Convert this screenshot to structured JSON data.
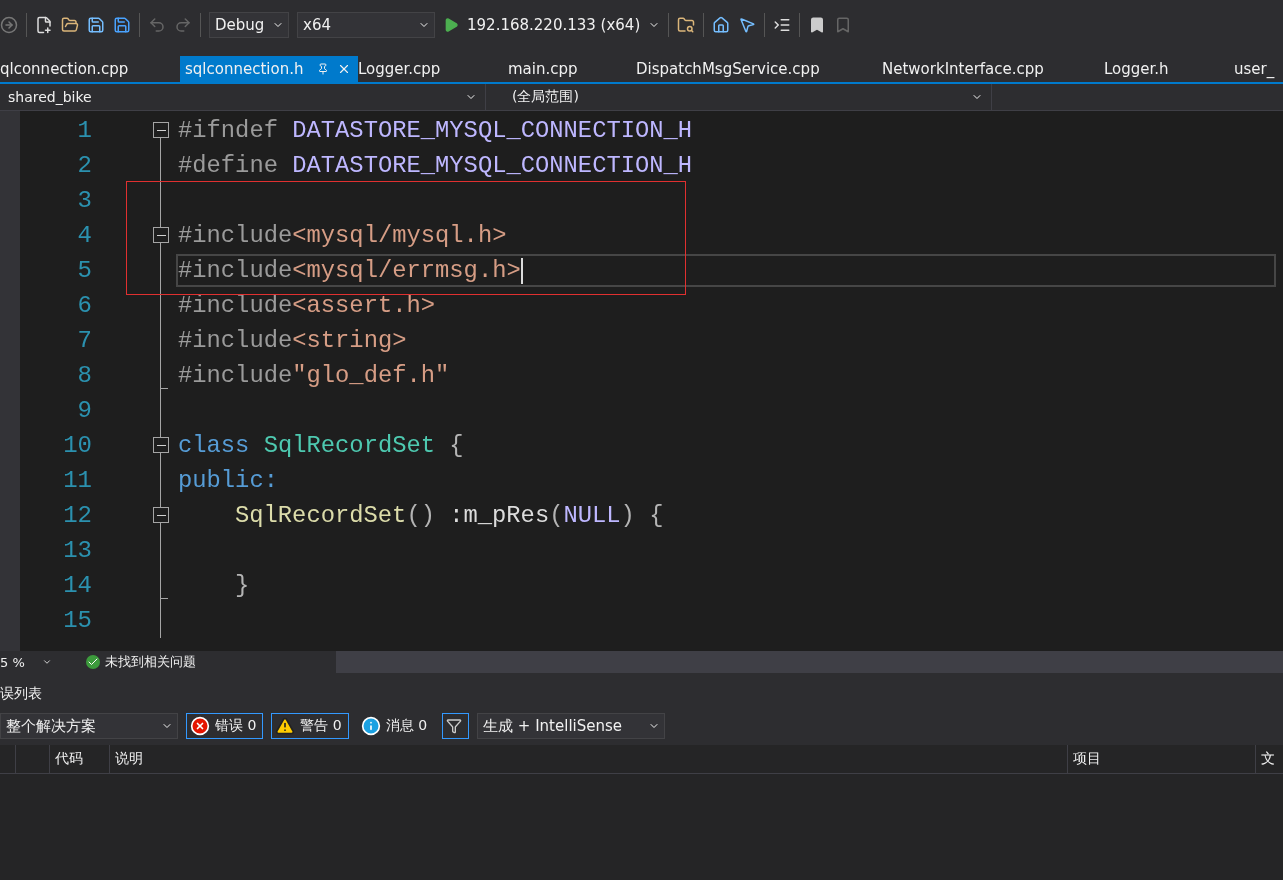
{
  "toolbar": {
    "configuration": "Debug",
    "platform": "x64",
    "run_target": "192.168.220.133 (x64)"
  },
  "tabs": [
    {
      "label": "qlconnection.cpp",
      "selected": false
    },
    {
      "label": "sqlconnection.h",
      "selected": true
    },
    {
      "label": "Logger.cpp",
      "selected": false
    },
    {
      "label": "main.cpp",
      "selected": false
    },
    {
      "label": "DispatchMsgService.cpp",
      "selected": false
    },
    {
      "label": "NetworkInterface.cpp",
      "selected": false
    },
    {
      "label": "Logger.h",
      "selected": false
    },
    {
      "label": "user_",
      "selected": false
    }
  ],
  "navigation": {
    "project": "shared_bike",
    "scope": "(全局范围)"
  },
  "editor": {
    "lines": [
      {
        "number": "1",
        "collapsible": true,
        "fold_end": false,
        "indented": false,
        "current": false,
        "tokens": [
          {
            "kind": "preproc",
            "text": "#ifndef "
          },
          {
            "kind": "macro",
            "text": "DATASTORE_MYSQL_CONNECTION_H"
          }
        ]
      },
      {
        "number": "2",
        "collapsible": false,
        "fold_end": false,
        "indented": false,
        "current": false,
        "tokens": [
          {
            "kind": "preproc",
            "text": "#define "
          },
          {
            "kind": "macro",
            "text": "DATASTORE_MYSQL_CONNECTION_H"
          }
        ]
      },
      {
        "number": "3",
        "collapsible": false,
        "fold_end": false,
        "indented": false,
        "current": false
      },
      {
        "number": "4",
        "collapsible": true,
        "fold_end": false,
        "indented": false,
        "current": false,
        "tokens": [
          {
            "kind": "preproc",
            "text": "#include"
          },
          {
            "kind": "string",
            "text": "<mysql/mysql.h>"
          }
        ]
      },
      {
        "number": "5",
        "collapsible": false,
        "fold_end": false,
        "indented": false,
        "current": true,
        "tokens": [
          {
            "kind": "preproc",
            "text": "#include"
          },
          {
            "kind": "string",
            "text": "<mysql/errmsg.h>"
          }
        ]
      },
      {
        "number": "6",
        "collapsible": false,
        "fold_end": false,
        "indented": false,
        "current": false,
        "tokens": [
          {
            "kind": "preproc",
            "text": "#include"
          },
          {
            "kind": "string",
            "text": "<assert.h>"
          }
        ]
      },
      {
        "number": "7",
        "collapsible": false,
        "fold_end": false,
        "indented": false,
        "current": false,
        "tokens": [
          {
            "kind": "preproc",
            "text": "#include"
          },
          {
            "kind": "string",
            "text": "<string>"
          }
        ]
      },
      {
        "number": "8",
        "collapsible": false,
        "fold_end": true,
        "indented": false,
        "current": false,
        "tokens": [
          {
            "kind": "preproc",
            "text": "#include"
          },
          {
            "kind": "string",
            "text": "\"glo_def.h\""
          }
        ]
      },
      {
        "number": "9",
        "collapsible": false,
        "fold_end": false,
        "indented": false,
        "current": false
      },
      {
        "number": "10",
        "collapsible": true,
        "fold_end": false,
        "indented": false,
        "current": false,
        "tokens": [
          {
            "kind": "keyword",
            "text": "class "
          },
          {
            "kind": "type",
            "text": "SqlRecordSet"
          },
          {
            "kind": "punct",
            "text": " {"
          }
        ]
      },
      {
        "number": "11",
        "collapsible": false,
        "fold_end": false,
        "indented": false,
        "current": false,
        "tokens": [
          {
            "kind": "keyword",
            "text": "public:"
          }
        ]
      },
      {
        "number": "12",
        "collapsible": true,
        "fold_end": false,
        "indented": true,
        "current": false,
        "tokens": [
          {
            "kind": "function",
            "text": "SqlRecordSet"
          },
          {
            "kind": "punct",
            "text": "()"
          },
          {
            "kind": "plain",
            "text": " :m_pRes"
          },
          {
            "kind": "punct",
            "text": "("
          },
          {
            "kind": "macro",
            "text": "NULL"
          },
          {
            "kind": "punct",
            "text": ") {"
          }
        ]
      },
      {
        "number": "13",
        "collapsible": false,
        "fold_end": false,
        "indented": false,
        "current": false
      },
      {
        "number": "14",
        "collapsible": false,
        "fold_end": true,
        "indented": true,
        "current": false,
        "tokens": [
          {
            "kind": "punct",
            "text": "}"
          }
        ]
      },
      {
        "number": "15",
        "collapsible": false,
        "fold_end": false,
        "indented": false,
        "current": false
      }
    ]
  },
  "status_strip": {
    "zoom": "5 %",
    "issues": "未找到相关问题"
  },
  "error_list": {
    "title": "误列表",
    "scope": "整个解决方案",
    "filters": [
      {
        "kind": "error",
        "label": "错误 0",
        "selected": true
      },
      {
        "kind": "warning",
        "label": "警告 0",
        "selected": true
      },
      {
        "kind": "info",
        "label": "消息 0",
        "selected": false
      }
    ],
    "source": "生成 + IntelliSense",
    "columns": [
      "代码",
      "说明",
      "项目",
      "文"
    ]
  }
}
